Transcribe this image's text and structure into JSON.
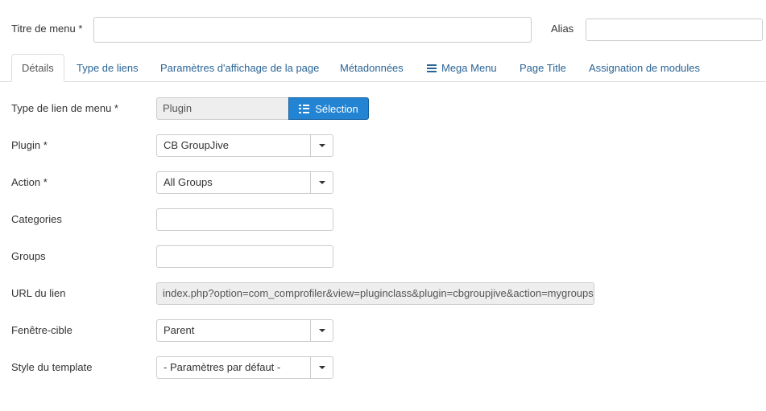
{
  "header": {
    "title_label": "Titre de menu *",
    "alias_label": "Alias",
    "title_value": "",
    "alias_value": ""
  },
  "tabs": [
    {
      "label": "Détails",
      "active": true
    },
    {
      "label": "Type de liens"
    },
    {
      "label": "Paramètres d'affichage de la page"
    },
    {
      "label": "Métadonnées"
    },
    {
      "label": "Mega Menu",
      "icon": "hamburger-icon"
    },
    {
      "label": "Page Title"
    },
    {
      "label": "Assignation de modules"
    }
  ],
  "form": {
    "menu_item_type": {
      "label": "Type de lien de menu *",
      "value": "Plugin",
      "button": "Sélection"
    },
    "plugin": {
      "label": "Plugin *",
      "value": "CB GroupJive"
    },
    "action": {
      "label": "Action *",
      "value": "All Groups"
    },
    "categories": {
      "label": "Categories",
      "value": ""
    },
    "groups": {
      "label": "Groups",
      "value": ""
    },
    "url": {
      "label": "URL du lien",
      "value": "index.php?option=com_comprofiler&view=pluginclass&plugin=cbgroupjive&action=mygroups"
    },
    "target": {
      "label": "Fenêtre-cible",
      "value": "Parent"
    },
    "template_style": {
      "label": "Style du template",
      "value": "- Paramètres par défaut -"
    }
  },
  "colors": {
    "accent_button": "#2384d3",
    "tab_link": "#2a6496"
  }
}
